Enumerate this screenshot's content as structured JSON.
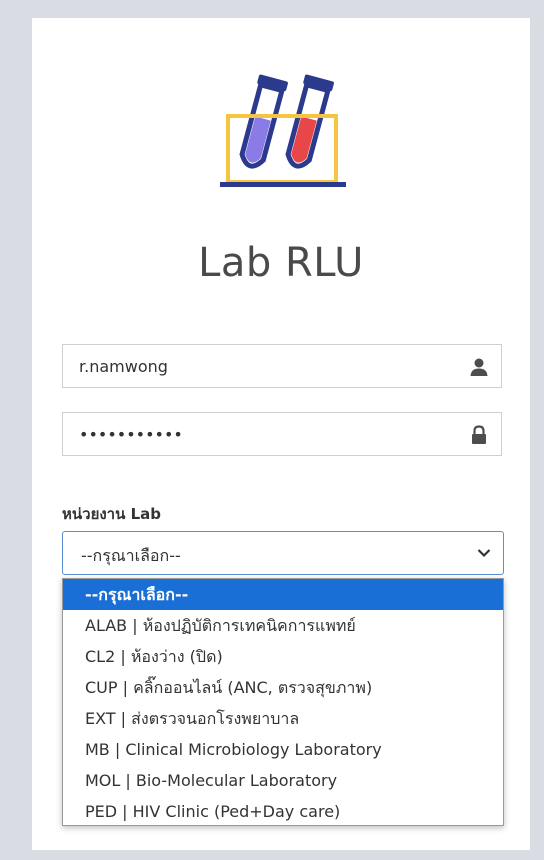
{
  "app": {
    "title": "Lab RLU"
  },
  "login": {
    "username_value": "r.namwong",
    "password_value": "•••••••••••"
  },
  "unit": {
    "label": "หน่วยงาน Lab",
    "selected": "--กรุณาเลือก--",
    "options": [
      "--กรุณาเลือก--",
      "ALAB | ห้องปฏิบัติการเทคนิคการแพทย์",
      "CL2 | ห้องว่าง (ปิด)",
      "CUP | คลิ๊กออนไลน์ (ANC, ตรวจสุขภาพ)",
      "EXT | ส่งตรวจนอกโรงพยาบาล",
      "MB | Clinical Microbiology Laboratory",
      "MOL | Bio-Molecular Laboratory",
      "PED | HIV Clinic (Ped+Day care)"
    ]
  },
  "colors": {
    "accent": "#1a6fd6",
    "logo_tube_navy": "#2b3a8c",
    "logo_liquid_purple": "#8a7be6",
    "logo_liquid_red": "#e8474a",
    "logo_rack_yellow": "#f5c542"
  },
  "icons": [
    "user-icon",
    "lock-icon",
    "chevron-down-icon",
    "test-tubes-logo"
  ]
}
